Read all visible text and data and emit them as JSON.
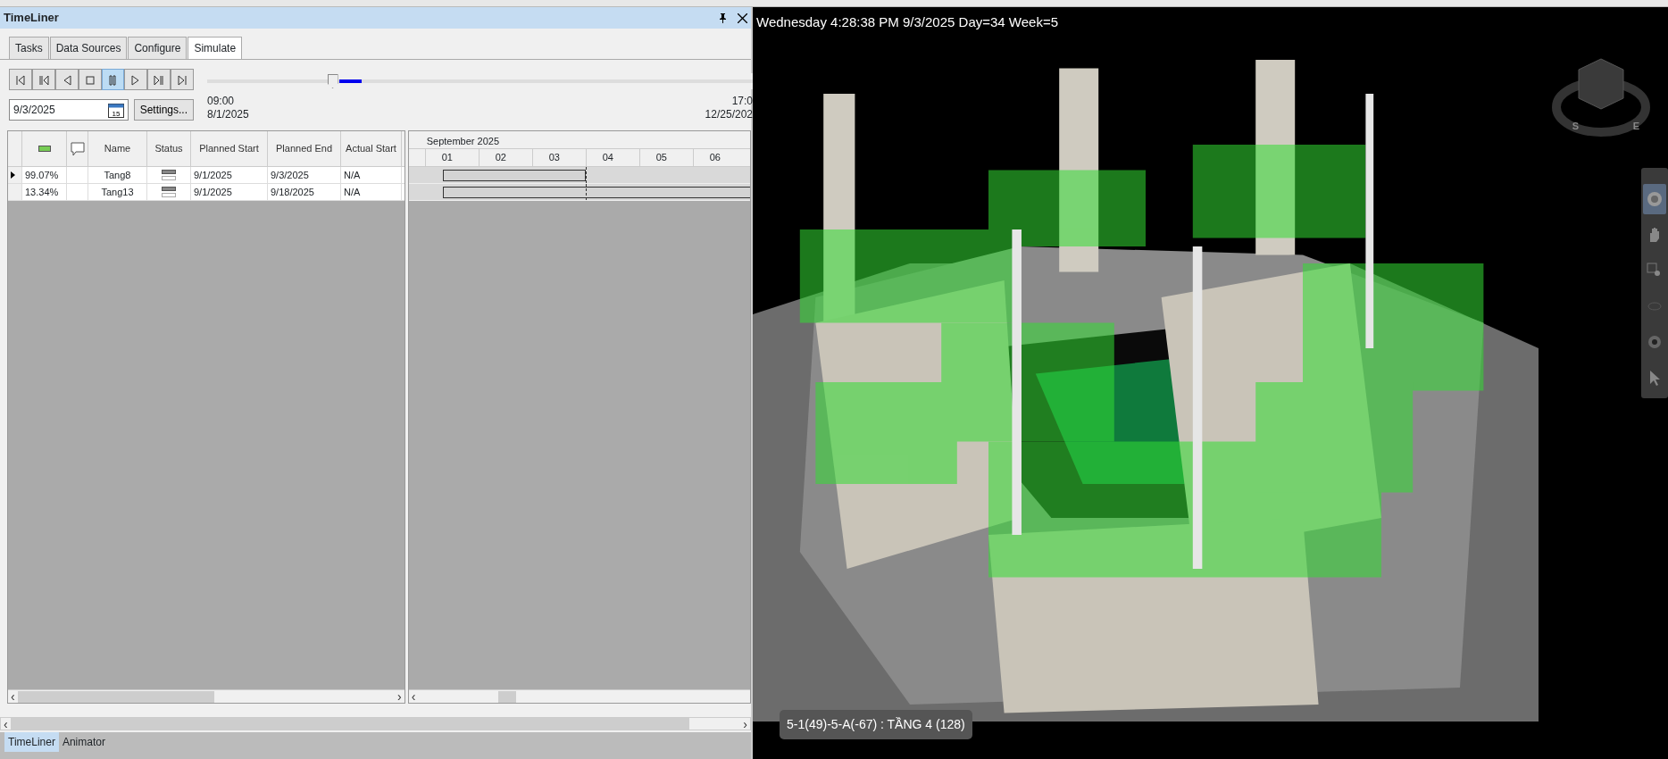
{
  "panel": {
    "title": "TimeLiner"
  },
  "tabs": [
    {
      "label": "Tasks",
      "selected": false
    },
    {
      "label": "Data Sources",
      "selected": false
    },
    {
      "label": "Configure",
      "selected": false
    },
    {
      "label": "Simulate",
      "selected": true
    }
  ],
  "playback_buttons": [
    {
      "kind": "first",
      "selected": false
    },
    {
      "kind": "step-back",
      "selected": false
    },
    {
      "kind": "reverse",
      "selected": false
    },
    {
      "kind": "stop",
      "selected": false
    },
    {
      "kind": "pause",
      "selected": true
    },
    {
      "kind": "play",
      "selected": false
    },
    {
      "kind": "step-forward",
      "selected": false
    },
    {
      "kind": "last",
      "selected": false
    }
  ],
  "slider": {
    "level": 0.23
  },
  "date_field": {
    "value": "9/3/2025",
    "calendar_day": "15"
  },
  "settings_button": "Settings...",
  "range_start": {
    "time": "09:00",
    "date": "8/1/2025"
  },
  "range_end": {
    "time": "17:0",
    "date": "12/25/202"
  },
  "table": {
    "columns": [
      "Name",
      "Status",
      "Planned Start",
      "Planned End",
      "Actual Start"
    ],
    "rows": [
      {
        "current": true,
        "progress": "99.07%",
        "name": "Tang8",
        "planned_start": "9/1/2025",
        "planned_end": "9/3/2025",
        "actual_start": "N/A"
      },
      {
        "current": false,
        "progress": "13.34%",
        "name": "Tang13",
        "planned_start": "9/1/2025",
        "planned_end": "9/18/2025",
        "actual_start": "N/A"
      }
    ]
  },
  "gantt": {
    "month": "September 2025",
    "days": [
      "01",
      "02",
      "03",
      "04",
      "05",
      "06"
    ]
  },
  "scrollbars": [
    {
      "left_arrow": "‹",
      "right_arrow": "›"
    },
    {
      "left_arrow": "‹"
    },
    {
      "left_arrow": "‹",
      "right_arrow": "›"
    }
  ],
  "bottom_tabs": [
    {
      "label": "TimeLiner",
      "selected": true
    },
    {
      "label": "Animator",
      "selected": false
    }
  ],
  "viewport": {
    "overlay_text": "Wednesday 4:28:38 PM 9/3/2025 Day=34 Week=5",
    "compass_labels": [
      "S",
      "E"
    ],
    "nav_tools": [
      {
        "kind": "wheel",
        "selected": true
      },
      {
        "kind": "pan",
        "selected": false
      },
      {
        "kind": "zoom",
        "selected": false
      },
      {
        "kind": "orbit",
        "selected": false
      },
      {
        "kind": "look",
        "selected": false
      },
      {
        "kind": "select",
        "selected": false
      }
    ],
    "tooltip": "5-1(49)-5-A(-67) : TẦNG 4 (128)"
  }
}
